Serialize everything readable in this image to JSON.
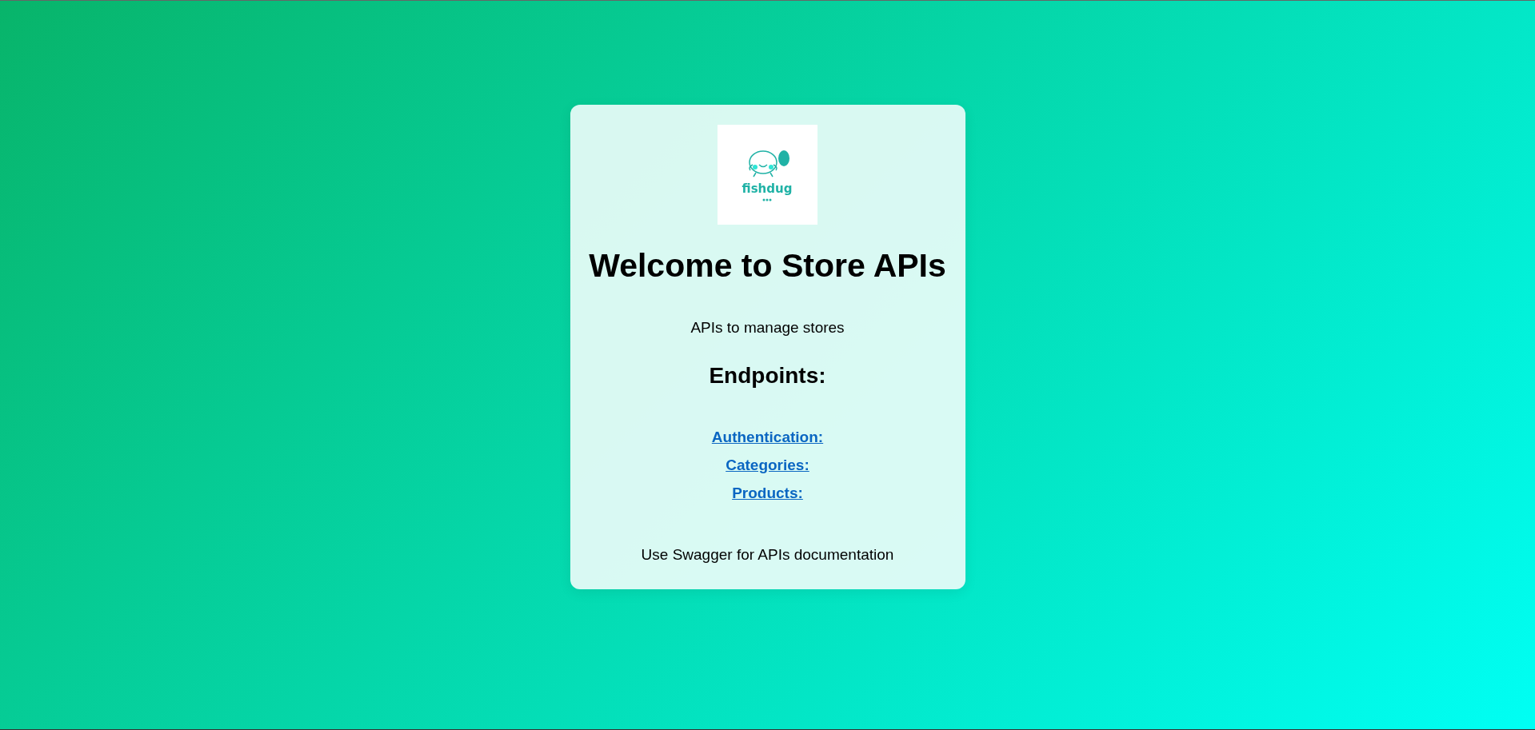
{
  "logo": {
    "text": "fishdug"
  },
  "title": "Welcome to Store APIs",
  "subtitle": "APIs to manage stores",
  "endpoints": {
    "heading": "Endpoints:",
    "links": [
      "Authentication:",
      "Categories:",
      "Products:"
    ]
  },
  "footer": "Use Swagger for APIs documentation"
}
